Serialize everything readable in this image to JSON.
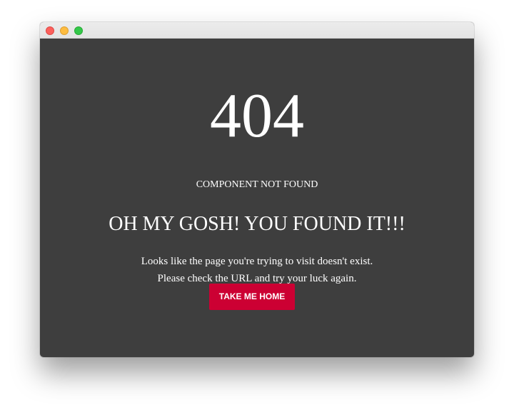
{
  "window": {
    "controls": [
      "close-icon",
      "minimize-icon",
      "maximize-icon"
    ]
  },
  "error": {
    "code": "404",
    "subtitle": "COMPONENT NOT FOUND",
    "headline": "OH MY GOSH! YOU FOUND IT!!!",
    "message_line1": "Looks like the page you're trying to visit doesn't exist.",
    "message_line2": "Please check the URL and try your luck again."
  },
  "actions": {
    "home_label": "TAKE ME HOME"
  },
  "colors": {
    "background": "#3e3e3e",
    "accent": "#cc0033",
    "text": "#ffffff",
    "close": "#fc605c",
    "minimize": "#fdbc40",
    "maximize": "#34c84a"
  }
}
